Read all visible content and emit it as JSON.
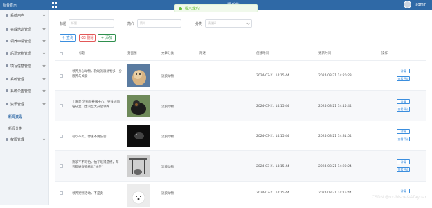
{
  "topbar": {
    "home_label": "后台首页",
    "app_title": "…………………………课系统",
    "user_name": "admin"
  },
  "toast": {
    "message": "提示成功!"
  },
  "sidebar": {
    "items": [
      {
        "label": "系统用户"
      },
      {
        "label": "完成培训管理"
      },
      {
        "label": "领养申请管理"
      },
      {
        "label": "后遗宠物管理"
      },
      {
        "label": "填写信息管理"
      },
      {
        "label": "系统管理"
      },
      {
        "label": "系统公告管理"
      },
      {
        "label": "资讯管理"
      }
    ],
    "sub_items": [
      {
        "label": "新闻资讯",
        "active": true
      },
      {
        "label": "新闻分类",
        "active": false
      }
    ],
    "bottom_item": {
      "label": "权限管理"
    }
  },
  "search": {
    "title_label": "标题",
    "title_placeholder": "标题",
    "summary_label": "简介",
    "summary_placeholder": "简介",
    "category_label": "分类",
    "category_placeholder": "请选择"
  },
  "toolbar": {
    "search_label": "查询",
    "delete_label": "删除",
    "add_label": "添加"
  },
  "table": {
    "columns": [
      "标题",
      "封面图",
      "文章分类",
      "简述",
      "创建时间",
      "更新时间",
      "操作"
    ],
    "rows": [
      {
        "title": "领养身心动物，救助流浪动物多一分思养与关爱",
        "category": "流浪动物",
        "created": "2024-03-21 14:15:44",
        "updated": "2024-03-21 14:20:23"
      },
      {
        "title": "上海是 宠物领养服中心，导致大面临成立，虚浪型大开放领养",
        "category": "流浪动物",
        "created": "2024-03-21 14:15:44",
        "updated": "2024-03-21 14:15:44"
      },
      {
        "title": "可以不卖，你逢不要伤害!",
        "category": "流浪动物",
        "created": "2024-03-21 14:15:44",
        "updated": "2024-03-21 14:31:04"
      },
      {
        "title": "流浪不不可怕，怕了吃得遗憾，每一只都通宠物看标\"好伴\"",
        "category": "流浪动物",
        "created": "2024-03-21 14:15:44",
        "updated": "2024-03-21 14:20:24"
      },
      {
        "title": "领养宠物活动，不是卖",
        "category": "流浪动物",
        "created": "2024-03-21 14:15:44",
        "updated": "2024-03-21 14:15:44"
      }
    ],
    "detail_label": "详情",
    "comment_label": "查看评论"
  },
  "watermark": "CSDN @vx-bishe&&fayuar"
}
